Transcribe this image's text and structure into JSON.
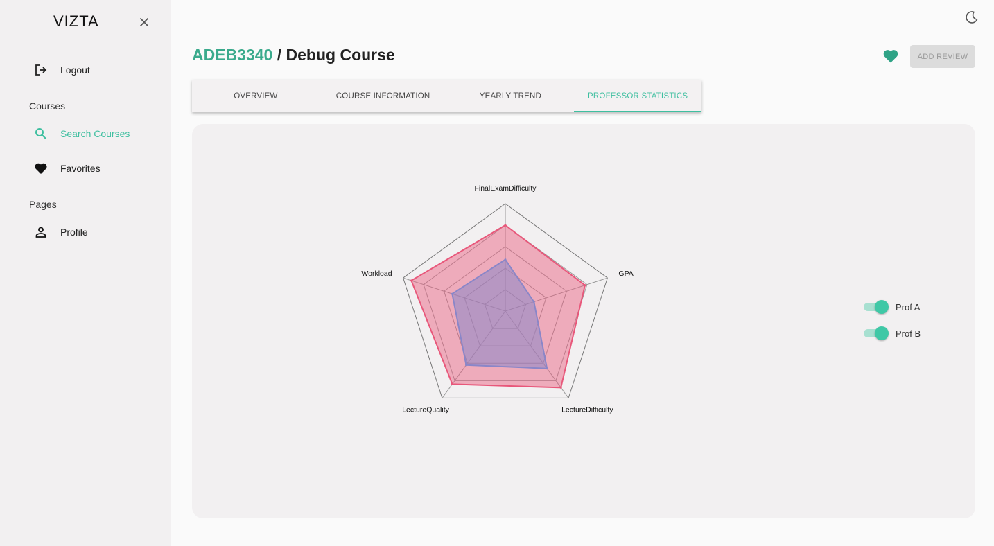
{
  "sidebar": {
    "brand": "VIZTA",
    "logout_label": "Logout",
    "courses_section": "Courses",
    "search_courses_label": "Search Courses",
    "favorites_label": "Favorites",
    "pages_section": "Pages",
    "profile_label": "Profile"
  },
  "header": {
    "course_code": "ADEB3340",
    "separator": " / ",
    "course_name": "Debug Course",
    "add_review_label": "ADD REVIEW"
  },
  "tabs": [
    {
      "label": "OVERVIEW",
      "active": false
    },
    {
      "label": "COURSE INFORMATION",
      "active": false
    },
    {
      "label": "YEARLY TREND",
      "active": false
    },
    {
      "label": "PROFESSOR STATISTICS",
      "active": true
    }
  ],
  "colors": {
    "accent": "#3fbfa0",
    "prof_a": "#e8577a",
    "prof_b": "#8a86c8"
  },
  "chart_data": {
    "type": "radar",
    "axes": [
      "FinalExamDifficulty",
      "GPA",
      "LectureDifficulty",
      "LectureQuality",
      "Workload"
    ],
    "rmax": 5,
    "rings": 5,
    "series": [
      {
        "name": "Prof A",
        "values": [
          4.0,
          3.9,
          4.4,
          4.2,
          4.6
        ]
      },
      {
        "name": "Prof B",
        "values": [
          2.4,
          1.4,
          3.3,
          3.1,
          2.6
        ]
      }
    ]
  },
  "legend": [
    {
      "label": "Prof A",
      "enabled": true
    },
    {
      "label": "Prof B",
      "enabled": true
    }
  ]
}
